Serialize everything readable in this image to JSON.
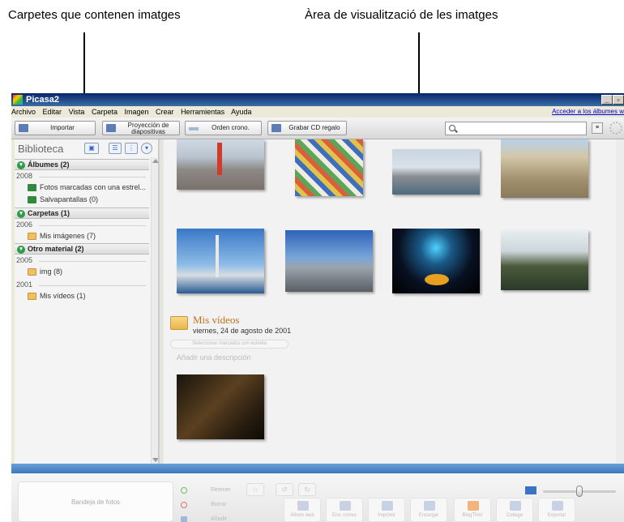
{
  "annotations": {
    "left": "Carpetes que contenen imatges",
    "right": "Àrea de visualització de les imatges"
  },
  "window": {
    "title": "Picasa2",
    "minimize": "_",
    "maximize": "▫"
  },
  "menu": {
    "items": [
      "Archivo",
      "Editar",
      "Vista",
      "Carpeta",
      "Imagen",
      "Crear",
      "Herramientas",
      "Ayuda"
    ],
    "album_link": "Acceder a los álbumes w"
  },
  "toolbar": {
    "import": "Importar",
    "slideshow_line1": "Proyección de",
    "slideshow_line2": "diapositivas",
    "chrono": "Orden crono.",
    "burn": "Grabar CD regalo",
    "search_placeholder": ""
  },
  "library": {
    "title": "Biblioteca",
    "groups": [
      {
        "name": "Álbumes (2)",
        "years": [
          {
            "year": "2008",
            "items": [
              "Fotos marcadas con una estrel...",
              "Salvapantallas (0)"
            ]
          }
        ]
      },
      {
        "name": "Carpetas (1)",
        "years": [
          {
            "year": "2006",
            "items": [
              "Mis imágenes (7)"
            ]
          }
        ]
      },
      {
        "name": "Otro material (2)",
        "years": [
          {
            "year": "2005",
            "items": [
              "img (8)"
            ]
          },
          {
            "year": "2001",
            "items": [
              "Mis vídeos (1)"
            ]
          }
        ]
      }
    ]
  },
  "gallery": {
    "video_folder": {
      "title": "Mis vídeos",
      "date": "viernes, 24 de agosto de 2001",
      "star_btn": "Seleccionar marcados con estrella",
      "description_placeholder": "Añadir una descripción"
    }
  },
  "tray": {
    "label": "Bandeja de fotos",
    "actions": [
      "Retener",
      "Borrar",
      "Añadir"
    ],
    "buttons": [
      "Álbum web",
      "Env. correo",
      "Imprimir",
      "Encargar",
      "BlogThis!",
      "Collage",
      "Exportar"
    ],
    "zoom_level": 0.5
  },
  "colors": {
    "title_bar": "#0a246a",
    "accent_blue": "#3c78bc",
    "folder_title": "#c07020",
    "group_toggle": "#2e9a4b"
  }
}
